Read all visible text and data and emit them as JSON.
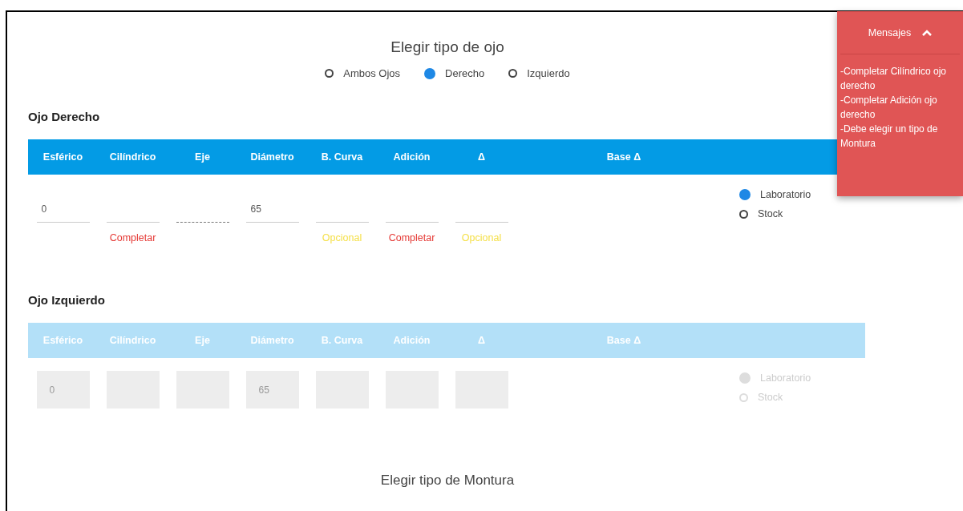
{
  "eye_type": {
    "title": "Elegir tipo de ojo",
    "options": [
      {
        "label": "Ambos Ojos",
        "selected": false
      },
      {
        "label": "Derecho",
        "selected": true
      },
      {
        "label": "Izquierdo",
        "selected": false
      }
    ]
  },
  "eyes": [
    {
      "title": "Ojo Derecho",
      "disabled": false,
      "columns": [
        "Esférico",
        "Cilíndrico",
        "Eje",
        "Diámetro",
        "B. Curva",
        "Adición",
        "Δ",
        "Base Δ"
      ],
      "fields": [
        {
          "value": "0"
        },
        {
          "hint": "Completar",
          "kind": "required"
        },
        {
          "kind": "dashed"
        },
        {
          "value": "65"
        },
        {
          "hint": "Opcional",
          "kind": "optional"
        },
        {
          "hint": "Completar",
          "kind": "required"
        },
        {
          "hint": "Opcional",
          "kind": "optional"
        }
      ],
      "source": [
        {
          "label": "Laboratorio",
          "selected": true
        },
        {
          "label": "Stock",
          "selected": false
        }
      ]
    },
    {
      "title": "Ojo Izquierdo",
      "disabled": true,
      "columns": [
        "Esférico",
        "Cilíndrico",
        "Eje",
        "Diámetro",
        "B. Curva",
        "Adición",
        "Δ",
        "Base Δ"
      ],
      "fields": [
        {
          "value": "0"
        },
        {
          "kind": "blank"
        },
        {
          "kind": "blank"
        },
        {
          "value": "65"
        },
        {
          "kind": "blank"
        },
        {
          "kind": "blank"
        },
        {
          "kind": "blank"
        }
      ],
      "source": [
        {
          "label": "Laboratorio",
          "selected": true
        },
        {
          "label": "Stock",
          "selected": false
        }
      ]
    }
  ],
  "frame_type": {
    "title": "Elegir tipo de Montura"
  },
  "messages": {
    "title": "Mensajes",
    "expanded": true,
    "items": [
      "-Completar Cilíndrico ojo derecho",
      "-Completar Adición ojo derecho",
      "-Debe elegir un tipo de Montura"
    ]
  }
}
